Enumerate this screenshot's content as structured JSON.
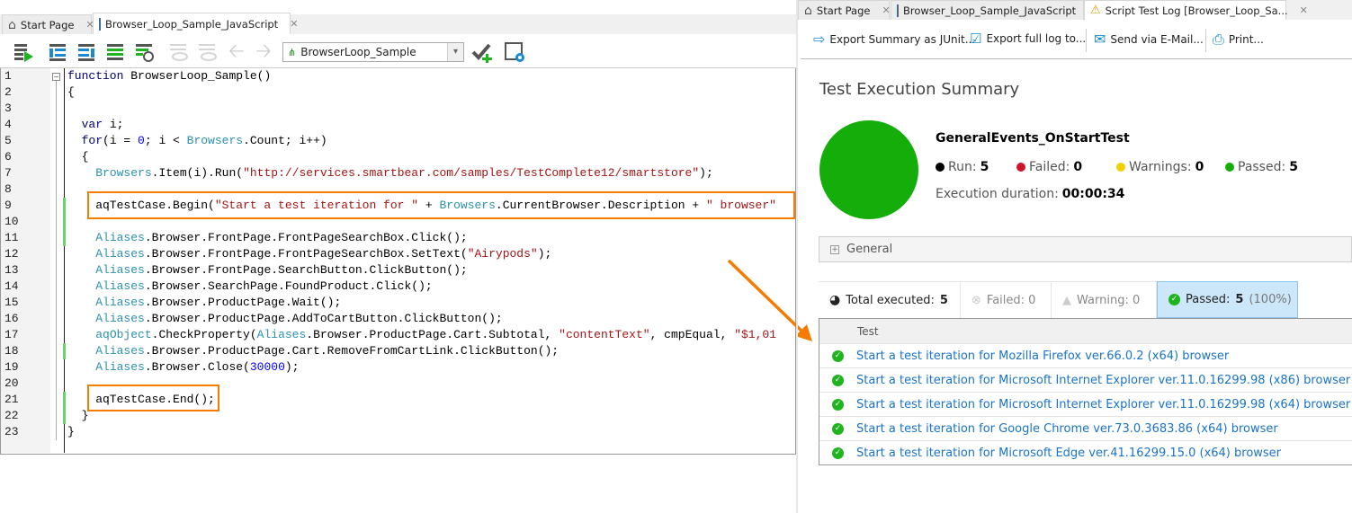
{
  "left": {
    "tabs": [
      {
        "label": "Start Page",
        "icon": "home-icon"
      },
      {
        "label": "Browser_Loop_Sample_JavaScript",
        "icon": "script-file-icon"
      }
    ],
    "routine_select": "BrowserLoop_Sample",
    "code_lines": [
      [
        [
          "k",
          "function"
        ],
        [
          "t",
          " BrowserLoop_Sample()"
        ]
      ],
      [
        [
          "t",
          "{"
        ]
      ],
      [],
      [
        [
          "t",
          "  "
        ],
        [
          "k",
          "var"
        ],
        [
          "t",
          " i;"
        ]
      ],
      [
        [
          "t",
          "  "
        ],
        [
          "k",
          "for"
        ],
        [
          "t",
          "(i = "
        ],
        [
          "n",
          "0"
        ],
        [
          "t",
          "; i < "
        ],
        [
          "o",
          "Browsers"
        ],
        [
          "t",
          ".Count; i++)"
        ]
      ],
      [
        [
          "t",
          "  {"
        ]
      ],
      [
        [
          "t",
          "    "
        ],
        [
          "o",
          "Browsers"
        ],
        [
          "t",
          ".Item(i).Run("
        ],
        [
          "s",
          "\"http://services.smartbear.com/samples/TestComplete12/smartstore\""
        ],
        [
          "t",
          ");"
        ]
      ],
      [],
      [
        [
          "t",
          "    aqTestCase.Begin("
        ],
        [
          "s",
          "\"Start a test iteration for \""
        ],
        [
          "t",
          " + "
        ],
        [
          "o",
          "Browsers"
        ],
        [
          "t",
          ".CurrentBrowser.Description + "
        ],
        [
          "s",
          "\" browser\""
        ]
      ],
      [],
      [
        [
          "t",
          "    "
        ],
        [
          "o",
          "Aliases"
        ],
        [
          "t",
          ".Browser.FrontPage.FrontPageSearchBox.Click();"
        ]
      ],
      [
        [
          "t",
          "    "
        ],
        [
          "o",
          "Aliases"
        ],
        [
          "t",
          ".Browser.FrontPage.FrontPageSearchBox.SetText("
        ],
        [
          "s",
          "\"Airypods\""
        ],
        [
          "t",
          ");"
        ]
      ],
      [
        [
          "t",
          "    "
        ],
        [
          "o",
          "Aliases"
        ],
        [
          "t",
          ".Browser.FrontPage.SearchButton.ClickButton();"
        ]
      ],
      [
        [
          "t",
          "    "
        ],
        [
          "o",
          "Aliases"
        ],
        [
          "t",
          ".Browser.SearchPage.FoundProduct.Click();"
        ]
      ],
      [
        [
          "t",
          "    "
        ],
        [
          "o",
          "Aliases"
        ],
        [
          "t",
          ".Browser.ProductPage.Wait();"
        ]
      ],
      [
        [
          "t",
          "    "
        ],
        [
          "o",
          "Aliases"
        ],
        [
          "t",
          ".Browser.ProductPage.AddToCartButton.ClickButton();"
        ]
      ],
      [
        [
          "t",
          "    "
        ],
        [
          "o",
          "aqObject"
        ],
        [
          "t",
          ".CheckProperty("
        ],
        [
          "o",
          "Aliases"
        ],
        [
          "t",
          ".Browser.ProductPage.Cart.Subtotal, "
        ],
        [
          "s",
          "\"contentText\""
        ],
        [
          "t",
          ", cmpEqual, "
        ],
        [
          "s",
          "\"$1,01"
        ]
      ],
      [
        [
          "t",
          "    "
        ],
        [
          "o",
          "Aliases"
        ],
        [
          "t",
          ".Browser.ProductPage.Cart.RemoveFromCartLink.ClickButton();"
        ]
      ],
      [
        [
          "t",
          "    "
        ],
        [
          "o",
          "Aliases"
        ],
        [
          "t",
          ".Browser.Close("
        ],
        [
          "n",
          "30000"
        ],
        [
          "t",
          ");"
        ]
      ],
      [],
      [
        [
          "t",
          "    aqTestCase.End();"
        ]
      ],
      [
        [
          "t",
          "  }"
        ]
      ],
      [
        [
          "t",
          "}"
        ]
      ]
    ]
  },
  "right": {
    "tabs": [
      {
        "label": "Start Page"
      },
      {
        "label": "Browser_Loop_Sample_JavaScript"
      },
      {
        "label": "Script Test Log [Browser_Loop_Sa..."
      }
    ],
    "toolbar": {
      "export_junit": "Export Summary as JUnit...",
      "export_full": "Export full log to...",
      "send_email": "Send via E-Mail...",
      "print": "Print..."
    },
    "summary": {
      "title": "Test Execution Summary",
      "test_name": "GeneralEvents_OnStartTest",
      "run_label": "Run:",
      "run": "5",
      "failed_label": "Failed:",
      "failed": "0",
      "warnings_label": "Warnings:",
      "warnings": "0",
      "passed_label": "Passed:",
      "passed": "5",
      "duration_label": "Execution duration:",
      "duration": "00:00:34",
      "pass_fraction": 1.0
    },
    "general_section": "General",
    "filters": {
      "total_label": "Total executed:",
      "total": "5",
      "failed": "Failed: 0",
      "warning": "Warning: 0",
      "passed_label": "Passed:",
      "passed": "5",
      "passed_pct": "(100%)"
    },
    "table": {
      "header": "Test",
      "rows": [
        "Start a test iteration for Mozilla Firefox ver.66.0.2 (x64) browser",
        "Start a test iteration for Microsoft Internet Explorer ver.11.0.16299.98 (x86) browser",
        "Start a test iteration for Microsoft Internet Explorer ver.11.0.16299.98 (x64) browser",
        "Start a test iteration for Google Chrome ver.73.0.3683.86 (x64) browser",
        "Start a test iteration for Microsoft Edge ver.41.16299.15.0 (x64) browser"
      ]
    }
  },
  "colors": {
    "accent_orange": "#f57c00",
    "pass_green": "#14ad0a",
    "link_blue": "#1a73c8"
  }
}
